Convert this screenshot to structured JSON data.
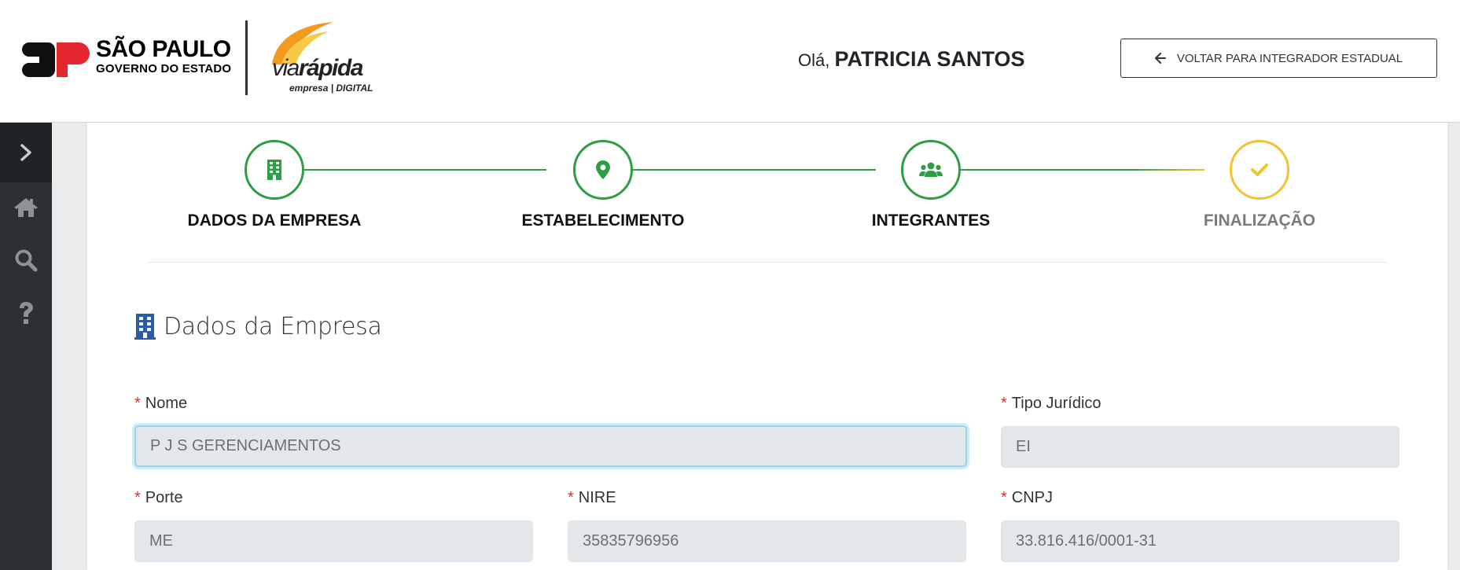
{
  "header": {
    "logo_sp": {
      "title": "SÃO PAULO",
      "subtitle": "GOVERNO DO ESTADO"
    },
    "logo_via": {
      "via": "via",
      "rapida": "rápida",
      "tagline": "empresa | DIGITAL"
    },
    "greeting_prefix": "Olá,",
    "user_name": "PATRICIA SANTOS",
    "back_button_label": "VOLTAR PARA INTEGRADOR ESTADUAL",
    "back_button_icon": "arrow-left-icon"
  },
  "sidebar": {
    "items": [
      {
        "icon": "chevron-right-icon"
      },
      {
        "icon": "home-icon"
      },
      {
        "icon": "search-icon"
      },
      {
        "icon": "question-icon"
      }
    ]
  },
  "stepper": {
    "steps": [
      {
        "label": "DADOS DA EMPRESA",
        "icon": "building-icon",
        "status": "complete"
      },
      {
        "label": "ESTABELECIMENTO",
        "icon": "map-marker-icon",
        "status": "complete"
      },
      {
        "label": "INTEGRANTES",
        "icon": "users-icon",
        "status": "complete"
      },
      {
        "label": "FINALIZAÇÃO",
        "icon": "check-icon",
        "status": "pending"
      }
    ]
  },
  "section": {
    "title": "Dados da Empresa",
    "icon": "building-icon"
  },
  "form": {
    "nome": {
      "label": "Nome",
      "value": "P J S GERENCIAMENTOS"
    },
    "tipo_juridico": {
      "label": "Tipo Jurídico",
      "value": "EI"
    },
    "porte": {
      "label": "Porte",
      "value": "ME"
    },
    "nire": {
      "label": "NIRE",
      "value": "35835796956"
    },
    "cnpj": {
      "label": "CNPJ",
      "value": "33.816.416/0001-31"
    }
  },
  "colors": {
    "complete": "#2e9e46",
    "pending": "#f2c230",
    "accent_red": "#e4262e",
    "orange": "#f29b1c",
    "sidebar_bg": "#2b3035",
    "required_mark": "#d9302b"
  }
}
